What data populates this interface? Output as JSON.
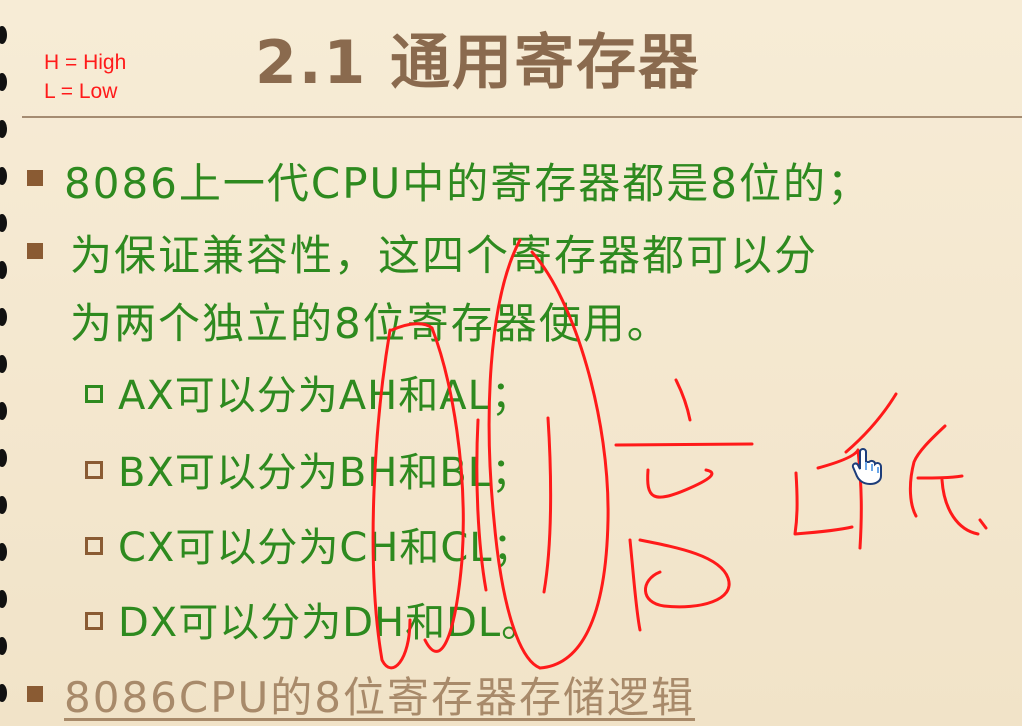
{
  "slide": {
    "title": "2.1 通用寄存器",
    "legend": {
      "high": "H = High",
      "low": "L = Low"
    },
    "points": [
      "8086上一代CPU中的寄存器都是8位的；",
      "为保证兼容性，这四个寄存器都可以分",
      "为两个独立的8位寄存器使用。"
    ],
    "subpoints": [
      "AX可以分为AH和AL；",
      "BX可以分为BH和BL；",
      "CX可以分为CH和CL；",
      "DX可以分为DH和DL。"
    ],
    "link": "8086CPU的8位寄存器存储逻辑"
  },
  "colors": {
    "background": "#f3e7cf",
    "title": "#8a6a4e",
    "body_text": "#2e8a1f",
    "bullet": "#8a5b33",
    "annotation_ink": "#ff1a1a"
  },
  "icons": [
    "ring-binding-icon",
    "hand-cursor-icon"
  ]
}
